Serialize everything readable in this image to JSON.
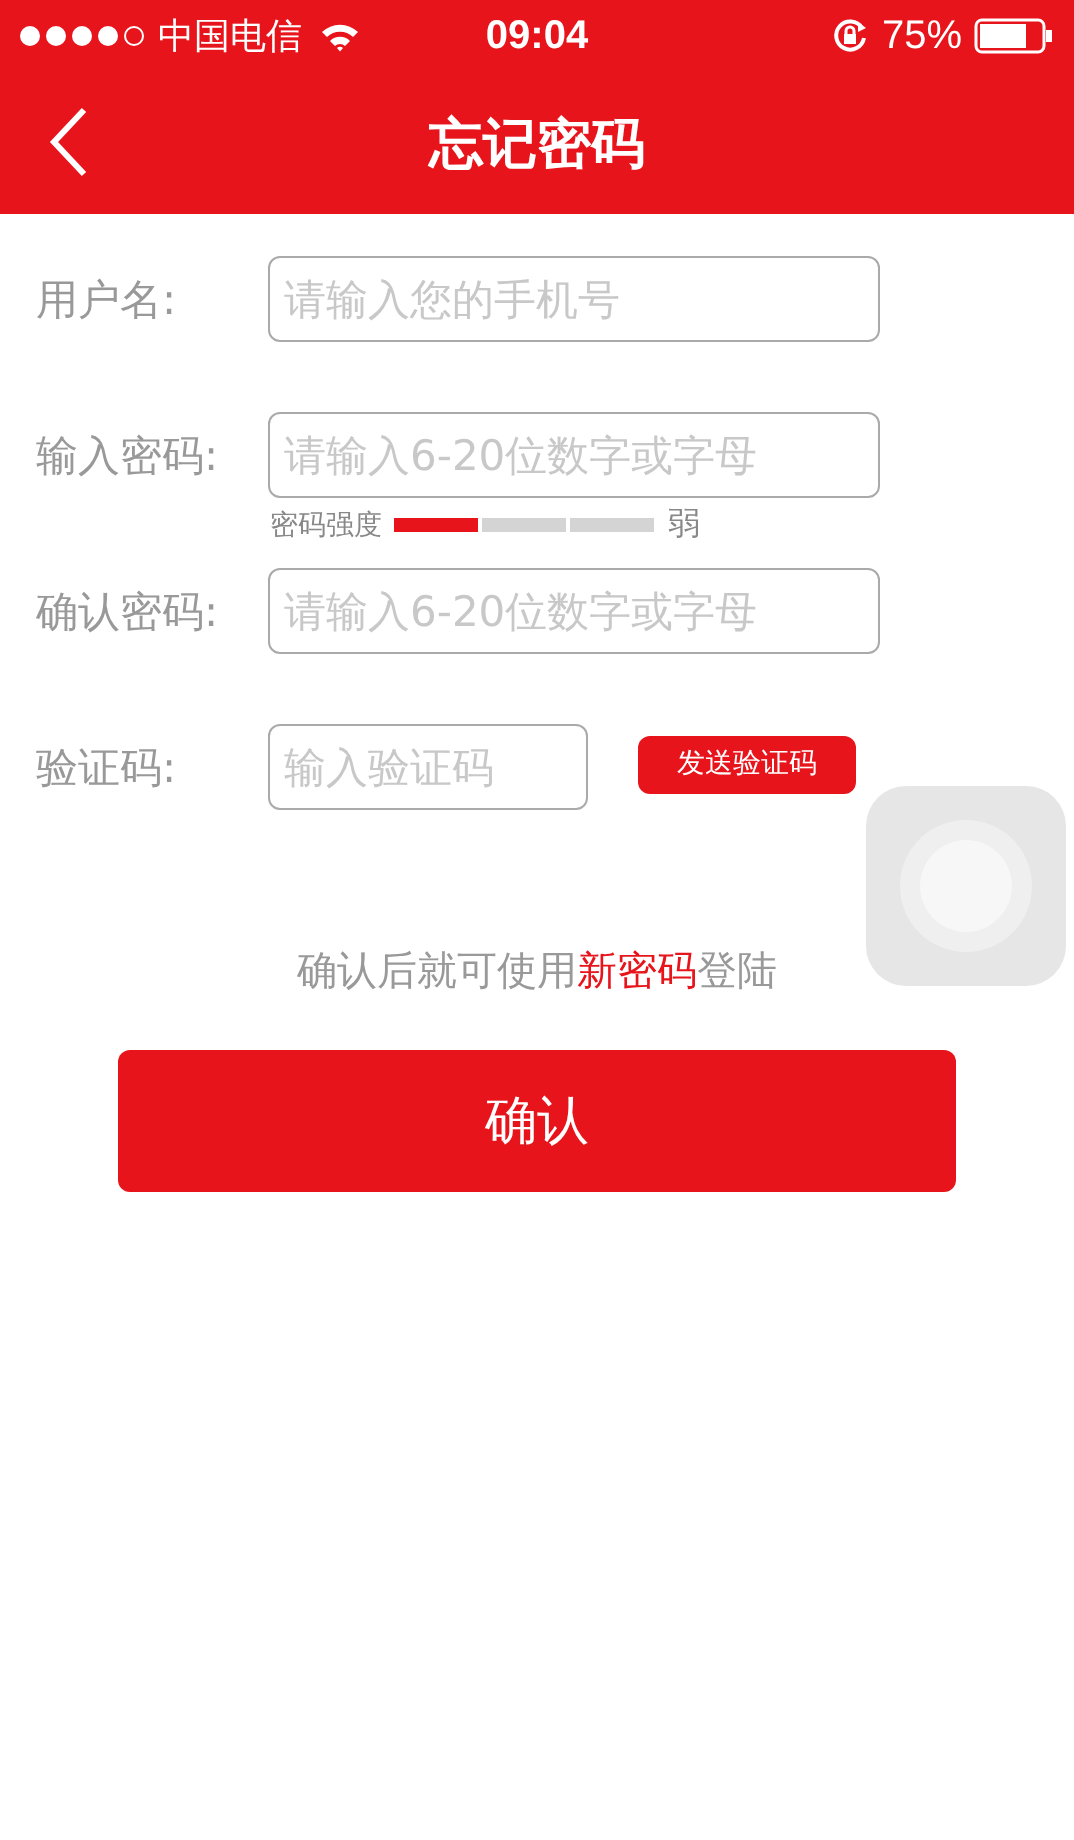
{
  "status_bar": {
    "signal_dots": [
      {
        "on": true
      },
      {
        "on": true
      },
      {
        "on": true
      },
      {
        "on": true
      },
      {
        "on": false
      }
    ],
    "carrier": "中国电信",
    "time": "09:04",
    "battery": "75%"
  },
  "nav": {
    "title": "忘记密码"
  },
  "fields": [
    {
      "label": "用户名:",
      "placeholder": "请输入您的手机号",
      "kind": "text"
    },
    {
      "label": "输入密码:",
      "placeholder": "请输入6-20位数字或字母",
      "kind": "password"
    },
    {
      "label": "确认密码:",
      "placeholder": "请输入6-20位数字或字母",
      "kind": "confirm"
    },
    {
      "label": "验证码:",
      "placeholder": "输入验证码",
      "kind": "code"
    }
  ],
  "strength": {
    "label": "密码强度",
    "segments": [
      {
        "on": true
      },
      {
        "on": false
      },
      {
        "on": false
      }
    ],
    "value": "弱"
  },
  "send_code_button": "发送验证码",
  "note": [
    {
      "text": "确认后就可使用",
      "highlight": false
    },
    {
      "text": "新密码",
      "highlight": true
    },
    {
      "text": "登陆",
      "highlight": false
    }
  ],
  "confirm_button": "确认"
}
